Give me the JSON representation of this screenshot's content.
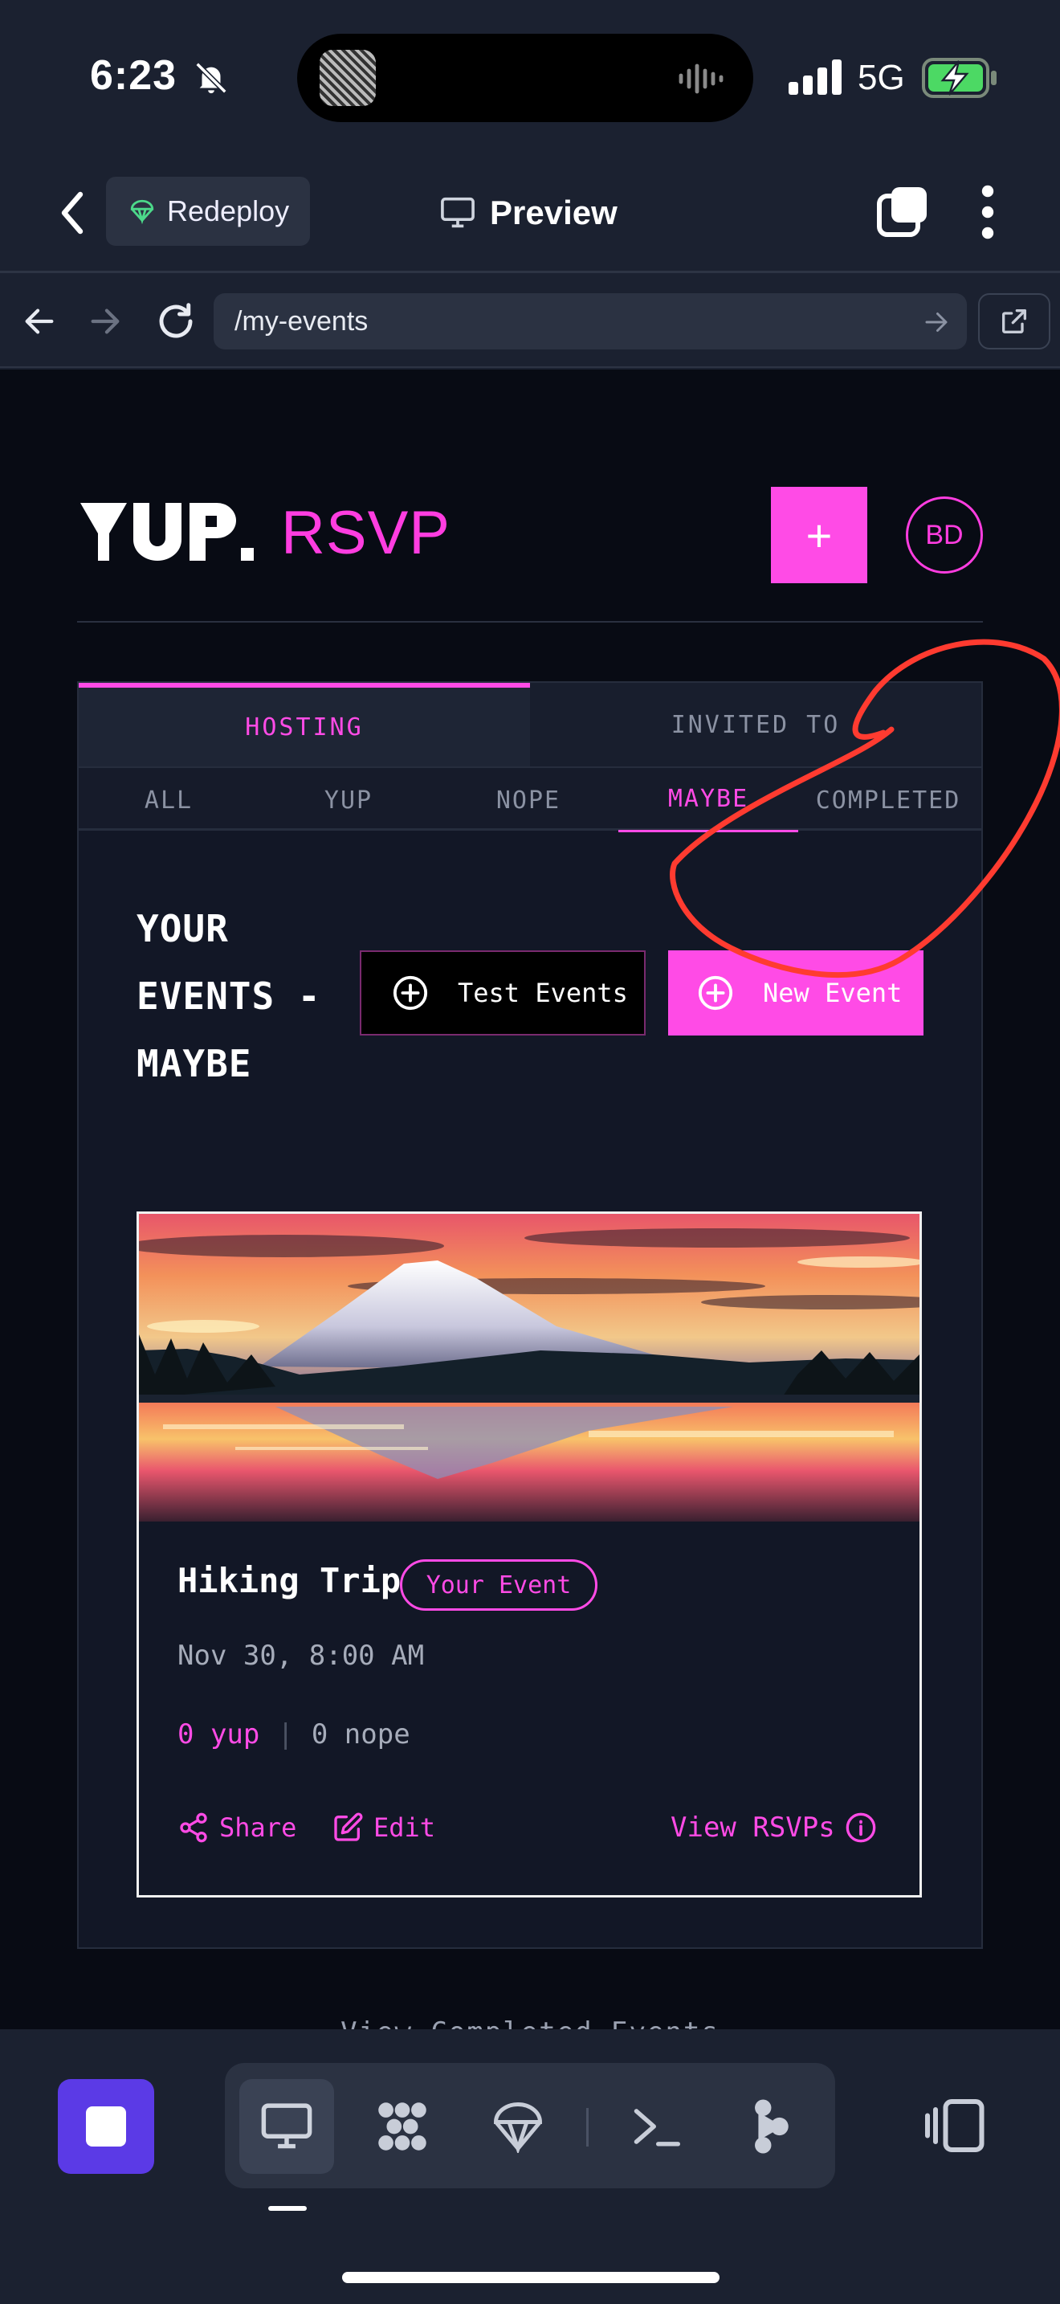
{
  "status_bar": {
    "time": "6:23",
    "network": "5G",
    "icons": [
      "bell-muted-icon",
      "signal-icon",
      "battery-charging-icon"
    ]
  },
  "app_bar": {
    "redeploy_label": "Redeploy",
    "title": "Preview"
  },
  "browser": {
    "url": "/my-events"
  },
  "site": {
    "logo_text": "YUP.",
    "logo_accent": "RSVP",
    "add_label": "+",
    "avatar_initials": "BD"
  },
  "tabs": {
    "main": [
      {
        "label": "HOSTING",
        "active": true
      },
      {
        "label": "INVITED TO",
        "active": false
      }
    ],
    "sub": [
      {
        "label": "ALL",
        "active": false
      },
      {
        "label": "YUP",
        "active": false
      },
      {
        "label": "NOPE",
        "active": false
      },
      {
        "label": "MAYBE",
        "active": true
      },
      {
        "label": "COMPLETED",
        "active": false
      }
    ]
  },
  "events_section": {
    "heading_lines": [
      "YOUR",
      "EVENTS -",
      "MAYBE"
    ],
    "test_events_label": "Test Events",
    "new_event_label": "New Event"
  },
  "event": {
    "title": "Hiking Trip",
    "badge": "Your Event",
    "date": "Nov 30, 8:00 AM",
    "yup_count": "0 yup",
    "separator": "|",
    "nope_count": "0 nope",
    "share_label": "Share",
    "edit_label": "Edit",
    "view_rsvps_label": "View RSVPs"
  },
  "footer_link": "View Completed Events",
  "colors": {
    "accent": "#ff4be6",
    "background": "#080b14",
    "panel": "#121726",
    "chrome": "#1b2130",
    "annotation": "#ff3b30"
  }
}
